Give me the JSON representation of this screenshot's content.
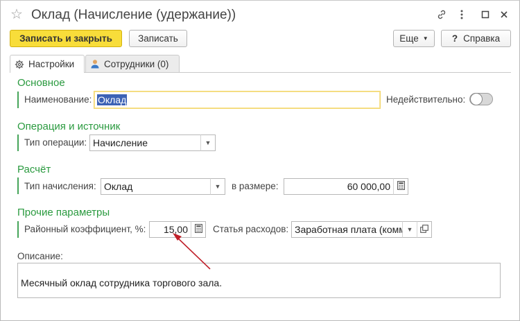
{
  "window": {
    "title": "Оклад (Начисление (удержание))",
    "icons": [
      "star-icon",
      "link-icon",
      "more-icon",
      "maximize-icon",
      "close-icon"
    ]
  },
  "toolbar": {
    "save_close_label": "Записать и закрыть",
    "save_label": "Записать",
    "more_label": "Еще",
    "help_label": "Справка",
    "help_glyph": "?"
  },
  "tabs": [
    {
      "label": "Настройки",
      "icon": "gear-icon",
      "active": true
    },
    {
      "label": "Сотрудники (0)",
      "icon": "user-icon",
      "active": false
    }
  ],
  "sections": {
    "basic": {
      "title": "Основное",
      "name_label": "Наименование:",
      "name_value": "Оклад",
      "invalid_label": "Недействительно:",
      "invalid_on": false
    },
    "operation": {
      "title": "Операция и источник",
      "type_label": "Тип операции:",
      "type_value": "Начисление"
    },
    "calc": {
      "title": "Расчёт",
      "kind_label": "Тип начисления:",
      "kind_value": "Оклад",
      "amount_label": "в размере:",
      "amount_value": "60 000,00"
    },
    "other": {
      "title": "Прочие параметры",
      "coef_label": "Районный коэффициент, %:",
      "coef_value": "15,00",
      "expense_label": "Статья расходов:",
      "expense_value": "Заработная плата (комм"
    }
  },
  "description": {
    "label": "Описание:",
    "value": "Месячный оклад сотрудника торгового зала."
  },
  "colors": {
    "accent_green": "#2a9a3f",
    "primary_button": "#f8dd3a",
    "annotation_arrow": "#c0202a"
  }
}
